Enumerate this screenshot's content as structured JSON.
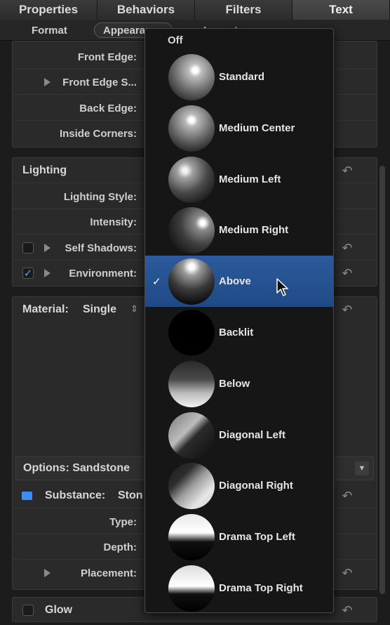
{
  "tabs": [
    "Properties",
    "Behaviors",
    "Filters",
    "Text"
  ],
  "subtabs": {
    "format": "Format",
    "appearance": "Appearance",
    "layout": "Layout"
  },
  "edges": {
    "front_edge": "Front Edge:",
    "front_edge_size": "Front Edge S...",
    "back_edge": "Back Edge:",
    "inside_corners": "Inside Corners:"
  },
  "lighting": {
    "title": "Lighting",
    "style": "Lighting Style:",
    "intensity": "Intensity:",
    "self_shadows": "Self Shadows:",
    "environment": "Environment:",
    "environment_checked": true
  },
  "material": {
    "label": "Material:",
    "value": "Single"
  },
  "options": {
    "label": "Options: Sandstone"
  },
  "substance": {
    "label": "Substance:",
    "value": "Ston",
    "type": "Type:",
    "depth": "Depth:",
    "placement": "Placement:"
  },
  "glow": {
    "label": "Glow"
  },
  "menu": {
    "off_label": "Off",
    "selected_index": 4,
    "items": [
      "Standard",
      "Medium Center",
      "Medium Left",
      "Medium Right",
      "Above",
      "Backlit",
      "Below",
      "Diagonal Left",
      "Diagonal Right",
      "Drama Top Left",
      "Drama Top Right"
    ]
  },
  "colors": {
    "accent": "#2c5a9c",
    "substance_swatch": "#3b8cff"
  }
}
